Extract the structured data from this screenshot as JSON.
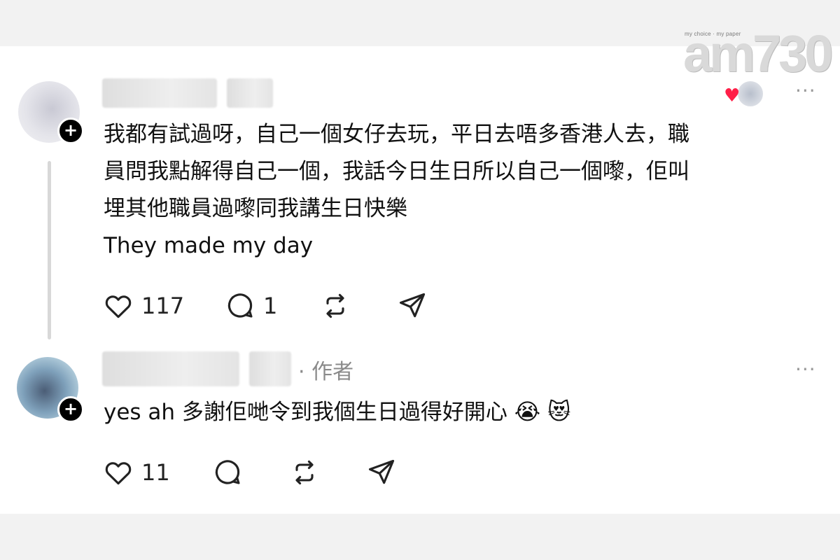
{
  "watermark": {
    "tagline": "my choice · my paper",
    "brand": "am730"
  },
  "reply1": {
    "text_lines": [
      "我都有試過呀，自己一個女仔去玩，平日去唔多香港人去，職",
      "員問我點解得自己一個，我話今日生日所以自己一個嚟，佢叫",
      "埋其他職員過嚟同我講生日快樂",
      "They made my day"
    ],
    "likes": "117",
    "replies": "1"
  },
  "reply2": {
    "author_tag": "· 作者",
    "text": "yes ah 多謝佢哋令到我個生日過得好開心",
    "emojis": [
      "😭",
      "😻"
    ],
    "likes": "11"
  },
  "ui": {
    "more_label": "···",
    "follow_label": "+",
    "heart_color": "#ff1f48"
  }
}
